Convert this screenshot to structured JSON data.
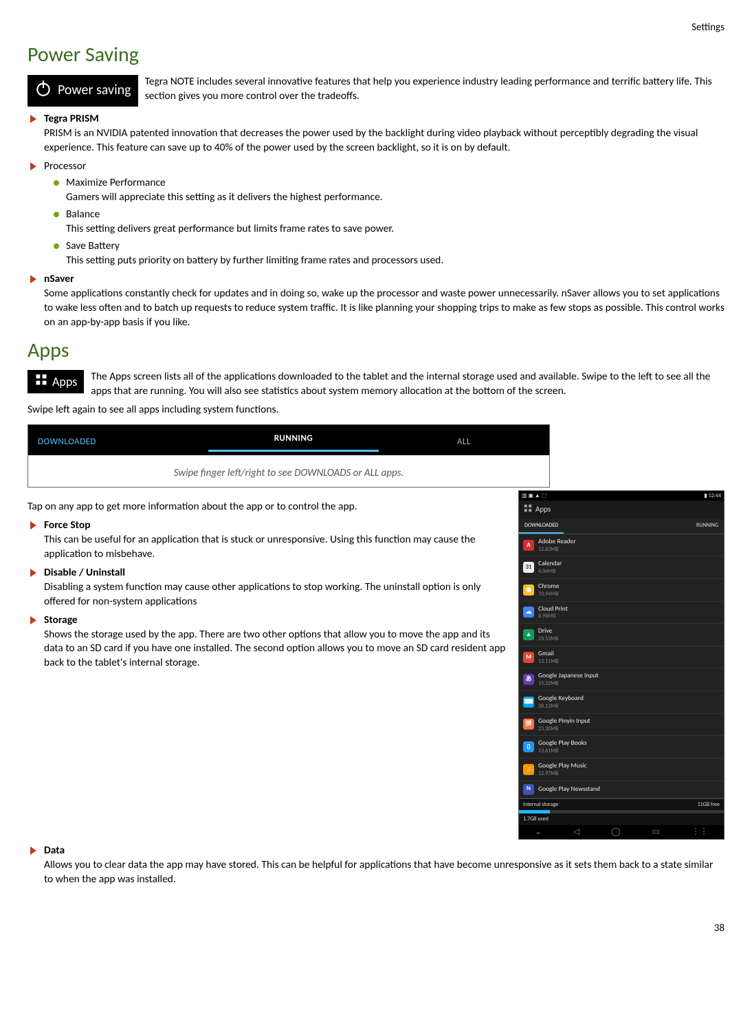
{
  "header": {
    "right": "Settings"
  },
  "page_number": "38",
  "power": {
    "heading": "Power Saving",
    "badge": "Power saving",
    "intro": "Tegra NOTE includes several innovative features that help you experience industry leading performance and terrific battery life. This section gives you more control over the tradeoffs.",
    "items": [
      {
        "title": "Tegra PRISM",
        "title_bold": true,
        "body": "PRISM is an NVIDIA patented innovation that decreases the power used by the backlight during video playback without perceptibly degrading the visual experience.  This feature can save up to 40% of the power used by the screen backlight, so it is on by default."
      },
      {
        "title": "Processor",
        "title_bold": false,
        "body": "",
        "sub": [
          {
            "title": "Maximize Performance",
            "body": "Gamers will appreciate this setting as it delivers the highest performance."
          },
          {
            "title": "Balance",
            "body": "This setting delivers great performance but limits frame rates to save power."
          },
          {
            "title": "Save Battery",
            "body": "This setting puts priority on battery by further limiting frame rates and processors used."
          }
        ]
      },
      {
        "title": "nSaver",
        "title_bold": true,
        "body": "Some applications constantly check for updates and in doing so, wake up the processor and waste power unnecessarily. nSaver allows you to set applications to wake less often and to batch up requests to reduce system traffic. It is like planning your shopping trips to make as few stops as possible.  This control works on an app-by-app basis if you like."
      }
    ]
  },
  "apps": {
    "heading": "Apps",
    "badge": "Apps",
    "intro": "The Apps screen lists all of the applications downloaded to the tablet and the internal storage used and available. Swipe to the left to see all the apps that are running. You will also see statistics about system memory allocation at the bottom of the screen.",
    "swipe_again": "Swipe left again to see all apps including system functions.",
    "tabs": {
      "left": "DOWNLOADED",
      "center": "RUNNING",
      "right": "ALL"
    },
    "swipe_caption": "Swipe finger left/right to see DOWNLOADS or ALL apps.",
    "tap_intro": "Tap on any app to get more information about the app or to control the app.",
    "items": [
      {
        "title": "Force Stop",
        "body": "This can be useful for an application that is stuck or unresponsive.  Using this function may cause the application to misbehave."
      },
      {
        "title": "Disable / Uninstall",
        "body": "Disabling a system function may cause other applications to stop working.  The uninstall option is only offered for non-system applications"
      },
      {
        "title": "Storage",
        "body": "Shows the storage used by the app.  There are two other options that allow you to move the app and its data to an SD card if you have one installed.  The second option allows you to move an SD card resident app back to the tablet's internal storage."
      },
      {
        "title": "Data",
        "body": "Allows you to clear data the app may have stored.  This can be helpful for applications that have become unresponsive as it sets them back to a state similar to when the app was installed."
      }
    ]
  },
  "phone": {
    "time": "12:44",
    "title": "Apps",
    "tab_dl": "DOWNLOADED",
    "tab_run": "RUNNING",
    "rows": [
      {
        "name": "Adobe Reader",
        "size": "12.63MB",
        "color": "#d32f2f",
        "t": "A"
      },
      {
        "name": "Calendar",
        "size": "4.04MB",
        "color": "#eceff1",
        "t": "31"
      },
      {
        "name": "Chrome",
        "size": "70.94MB",
        "color": "#fbc02d",
        "t": "◉"
      },
      {
        "name": "Cloud Print",
        "size": "8.98MB",
        "color": "#4285f4",
        "t": "☁"
      },
      {
        "name": "Drive",
        "size": "23.53MB",
        "color": "#0f9d58",
        "t": "▲"
      },
      {
        "name": "Gmail",
        "size": "13.11MB",
        "color": "#ea4335",
        "t": "M"
      },
      {
        "name": "Google Japanese Input",
        "size": "15.22MB",
        "color": "#673ab7",
        "t": "あ"
      },
      {
        "name": "Google Keyboard",
        "size": "28.13MB",
        "color": "#03a9f4",
        "t": "⌨"
      },
      {
        "name": "Google Pinyin Input",
        "size": "23.30MB",
        "color": "#ff7043",
        "t": "拼"
      },
      {
        "name": "Google Play Books",
        "size": "13.61MB",
        "color": "#2196f3",
        "t": "▯"
      },
      {
        "name": "Google Play Music",
        "size": "12.97MB",
        "color": "#ff9800",
        "t": "♫"
      },
      {
        "name": "Google Play Newsstand",
        "size": "",
        "color": "#3f51b5",
        "t": "N"
      }
    ],
    "storage_label": "Internal storage",
    "storage_used": "1.7GB used",
    "storage_free": "11GB free"
  }
}
